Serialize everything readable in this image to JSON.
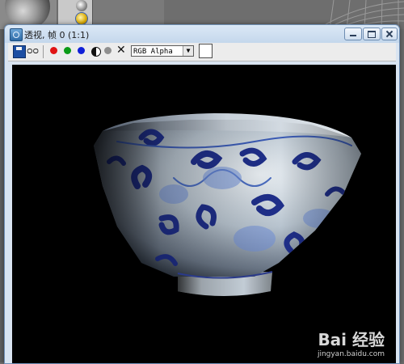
{
  "window": {
    "title": "透视, 帧 0 (1:1)"
  },
  "toolbar": {
    "channel_selected": "RGB Alpha",
    "icons": [
      "save-icon",
      "clone-icon",
      "red-channel-icon",
      "green-channel-icon",
      "blue-channel-icon",
      "monochrome-icon",
      "alpha-icon",
      "clear-icon"
    ],
    "colors": {
      "red": "#e01313",
      "green": "#0a9b17",
      "blue": "#1020d8"
    }
  },
  "render": {
    "background": "#000000",
    "subject": "blue-and-white porcelain bowl"
  },
  "watermark": {
    "logo_text": "Bai 经验",
    "url": "jingyan.baidu.com"
  }
}
